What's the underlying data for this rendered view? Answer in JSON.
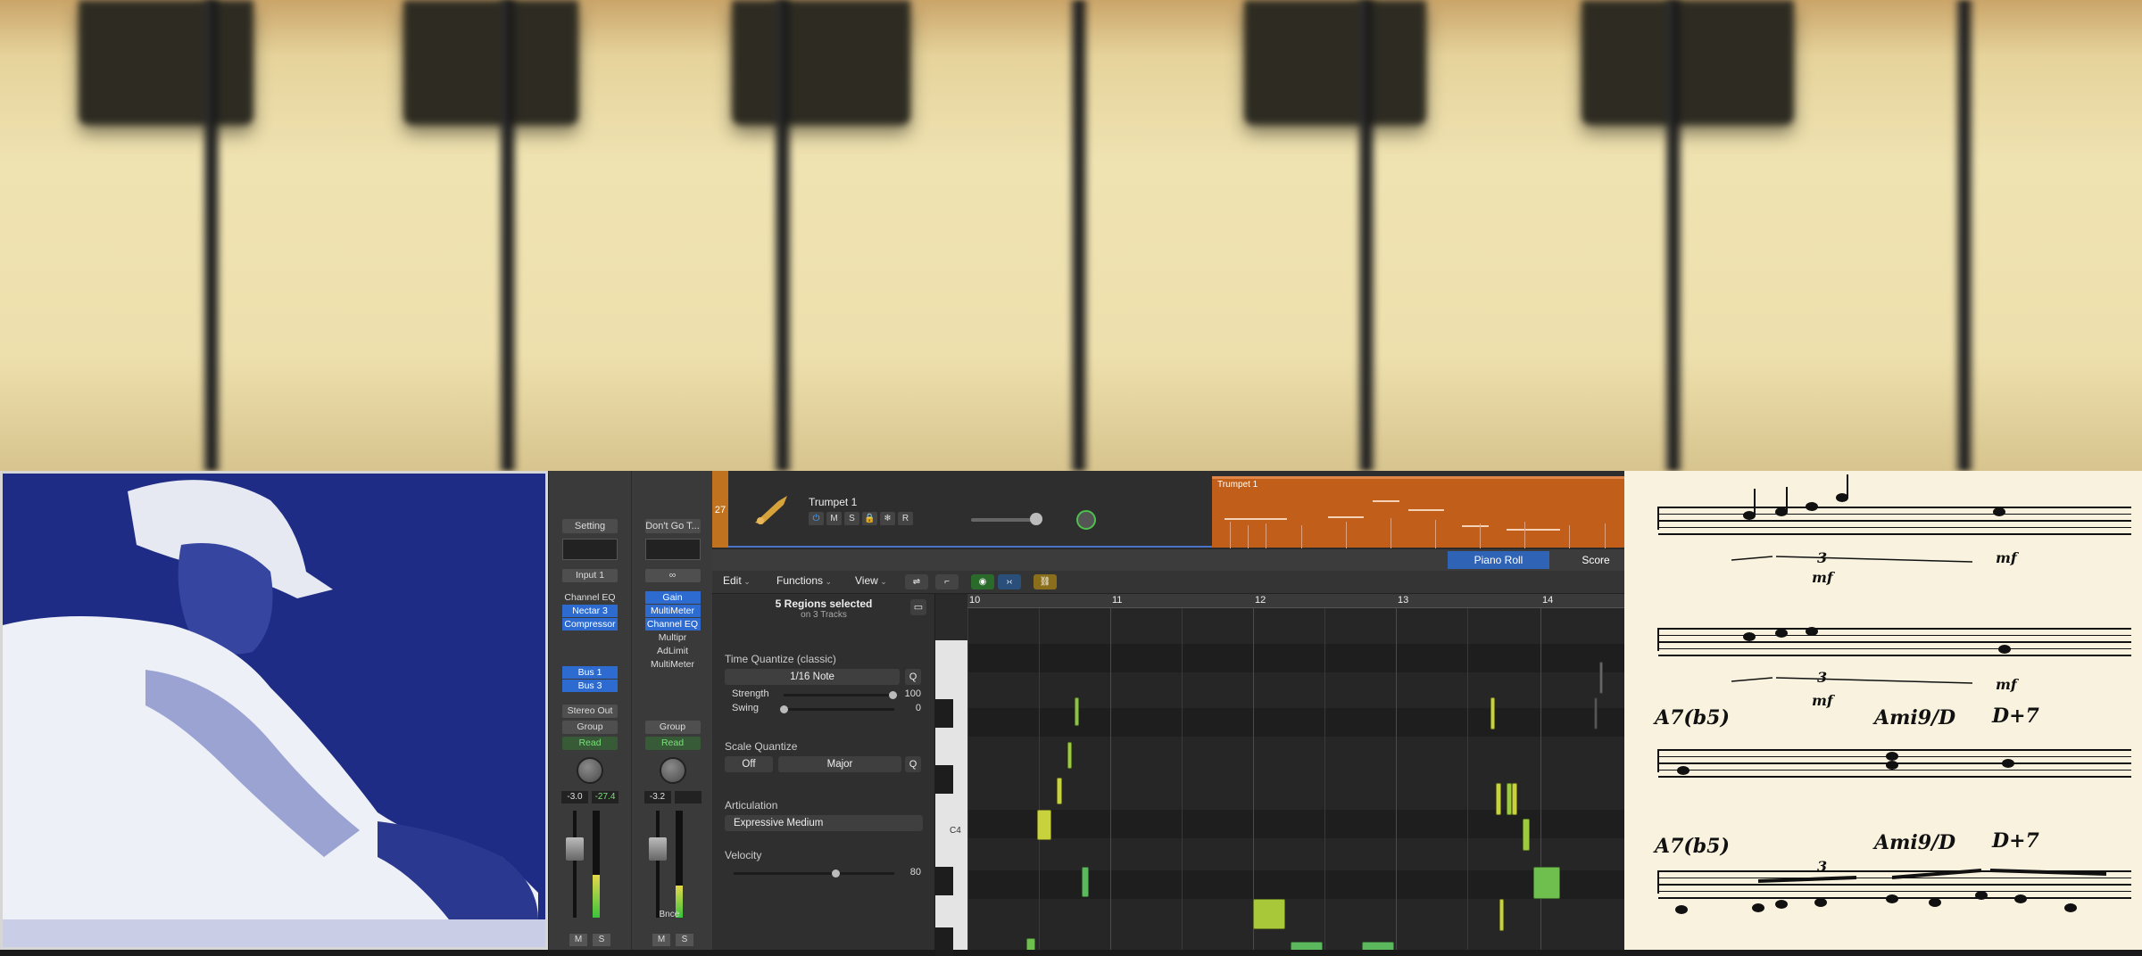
{
  "mixer": {
    "strips": [
      {
        "name": "Setting",
        "input": "Input 1",
        "plugins": [
          "Channel EQ",
          "Nectar 3",
          "Compressor"
        ],
        "plugins_highlighted": [
          false,
          true,
          true
        ],
        "sends": [
          "Bus 1",
          "Bus 3"
        ],
        "output": "Stereo Out",
        "group": "Group",
        "automation": "Read",
        "values": [
          "-3.0",
          "-27.4"
        ],
        "footer": [
          "M",
          "S"
        ]
      },
      {
        "name": "Don't Go T...",
        "input": "",
        "plugins": [
          "Gain",
          "MultiMeter",
          "Channel EQ",
          "Multipr",
          "AdLimit",
          "MultiMeter"
        ],
        "plugins_highlighted": [
          true,
          true,
          true,
          false,
          false,
          false
        ],
        "sends": [],
        "output": "",
        "group": "Group",
        "automation": "Read",
        "values": [
          "-3.2",
          ""
        ],
        "extra": "Bnce",
        "footer": [
          "M",
          "S"
        ]
      }
    ]
  },
  "track": {
    "number": "27",
    "name": "Trumpet 1",
    "buttons": [
      "⏻",
      "M",
      "S",
      "🔒",
      "❄",
      "R"
    ],
    "region_name": "Trumpet 1"
  },
  "tabs": {
    "piano_roll": "Piano Roll",
    "score": "Score"
  },
  "menus": {
    "edit": "Edit",
    "functions": "Functions",
    "view": "View"
  },
  "inspector": {
    "regions_selected": "5 Regions selected",
    "on_tracks": "on 3 Tracks",
    "time_quantize_title": "Time Quantize (classic)",
    "time_quantize_value": "1/16 Note",
    "q": "Q",
    "strength_label": "Strength",
    "strength_value": "100",
    "swing_label": "Swing",
    "swing_value": "0",
    "scale_quantize_title": "Scale Quantize",
    "scale_off": "Off",
    "scale_major": "Major",
    "articulation_title": "Articulation",
    "articulation_value": "Expressive Medium",
    "velocity_title": "Velocity",
    "velocity_value": "80"
  },
  "keyboard": {
    "c4_label": "C4"
  },
  "ruler": {
    "bars": [
      "10",
      "11",
      "12",
      "13",
      "14"
    ]
  },
  "score": {
    "chords": [
      "A7(b5)",
      "Ami9/D",
      "D+7",
      "A7(b5)",
      "Ami9/D",
      "D+7"
    ],
    "annotations": [
      "3",
      "mf",
      "mf",
      "3",
      "mf",
      "mf",
      "3"
    ]
  },
  "colors": {
    "note_green": "#7fbf3f",
    "note_yellow": "#c8d23c",
    "region_orange": "#c15f1a",
    "score_paper": "#f8f2de",
    "photo_blue": "#1e2c85"
  }
}
